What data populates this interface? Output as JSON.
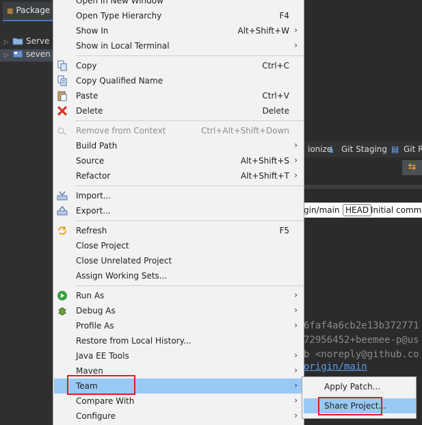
{
  "package_explorer": {
    "tab_label": "Package",
    "tree": [
      {
        "label": "Serve"
      },
      {
        "label": "seven"
      }
    ]
  },
  "git_toolbar": {
    "synchronize": "ionize",
    "staging": "Git Staging",
    "reflog": "Git Re"
  },
  "commit_bar": {
    "branch": "gin/main",
    "head": "HEAD",
    "message": "Initial commit"
  },
  "commit_details": {
    "hash": "6faf4a6cb2e13b372771",
    "author": "72956452+beemee-p@us",
    "committer": "b <noreply@github.co",
    "branch_link": "origin/main"
  },
  "context_menu": {
    "items": [
      {
        "label": "Open in New Window",
        "accel": "",
        "submenu": false
      },
      {
        "label": "Open Type Hierarchy",
        "accel": "F4",
        "submenu": false
      },
      {
        "label": "Show In",
        "accel": "Alt+Shift+W",
        "submenu": true
      },
      {
        "label": "Show in Local Terminal",
        "accel": "",
        "submenu": true
      },
      {
        "label": "Copy",
        "accel": "Ctrl+C",
        "submenu": false,
        "icon": "copy-icon"
      },
      {
        "label": "Copy Qualified Name",
        "accel": "",
        "submenu": false,
        "icon": "copy-qualified-name-icon"
      },
      {
        "label": "Paste",
        "accel": "Ctrl+V",
        "submenu": false,
        "icon": "paste-icon"
      },
      {
        "label": "Delete",
        "accel": "Delete",
        "submenu": false,
        "icon": "delete-icon"
      },
      {
        "label": "Remove from Context",
        "accel": "Ctrl+Alt+Shift+Down",
        "submenu": false,
        "icon": "remove-context-icon",
        "disabled": true
      },
      {
        "label": "Build Path",
        "accel": "",
        "submenu": true
      },
      {
        "label": "Source",
        "accel": "Alt+Shift+S",
        "submenu": true
      },
      {
        "label": "Refactor",
        "accel": "Alt+Shift+T",
        "submenu": true
      },
      {
        "label": "Import...",
        "accel": "",
        "submenu": false,
        "icon": "import-icon"
      },
      {
        "label": "Export...",
        "accel": "",
        "submenu": false,
        "icon": "export-icon"
      },
      {
        "label": "Refresh",
        "accel": "F5",
        "submenu": false,
        "icon": "refresh-icon"
      },
      {
        "label": "Close Project",
        "accel": "",
        "submenu": false
      },
      {
        "label": "Close Unrelated Project",
        "accel": "",
        "submenu": false
      },
      {
        "label": "Assign Working Sets...",
        "accel": "",
        "submenu": false
      },
      {
        "label": "Run As",
        "accel": "",
        "submenu": true,
        "icon": "run-icon"
      },
      {
        "label": "Debug As",
        "accel": "",
        "submenu": true,
        "icon": "debug-icon"
      },
      {
        "label": "Profile As",
        "accel": "",
        "submenu": true
      },
      {
        "label": "Restore from Local History...",
        "accel": "",
        "submenu": false
      },
      {
        "label": "Java EE Tools",
        "accel": "",
        "submenu": true
      },
      {
        "label": "Maven",
        "accel": "",
        "submenu": true
      },
      {
        "label": "Team",
        "accel": "",
        "submenu": true,
        "highlighted": true
      },
      {
        "label": "Compare With",
        "accel": "",
        "submenu": true
      },
      {
        "label": "Configure",
        "accel": "",
        "submenu": true
      }
    ]
  },
  "team_submenu": {
    "items": [
      {
        "label": "Apply Patch..."
      },
      {
        "label": "Share Project...",
        "highlighted": true
      }
    ]
  },
  "colors": {
    "menu_bg": "#f2f2f2",
    "highlight": "#99c9f5",
    "annotation_red": "#e01b24",
    "ide_dark": "#2b2b2b"
  }
}
